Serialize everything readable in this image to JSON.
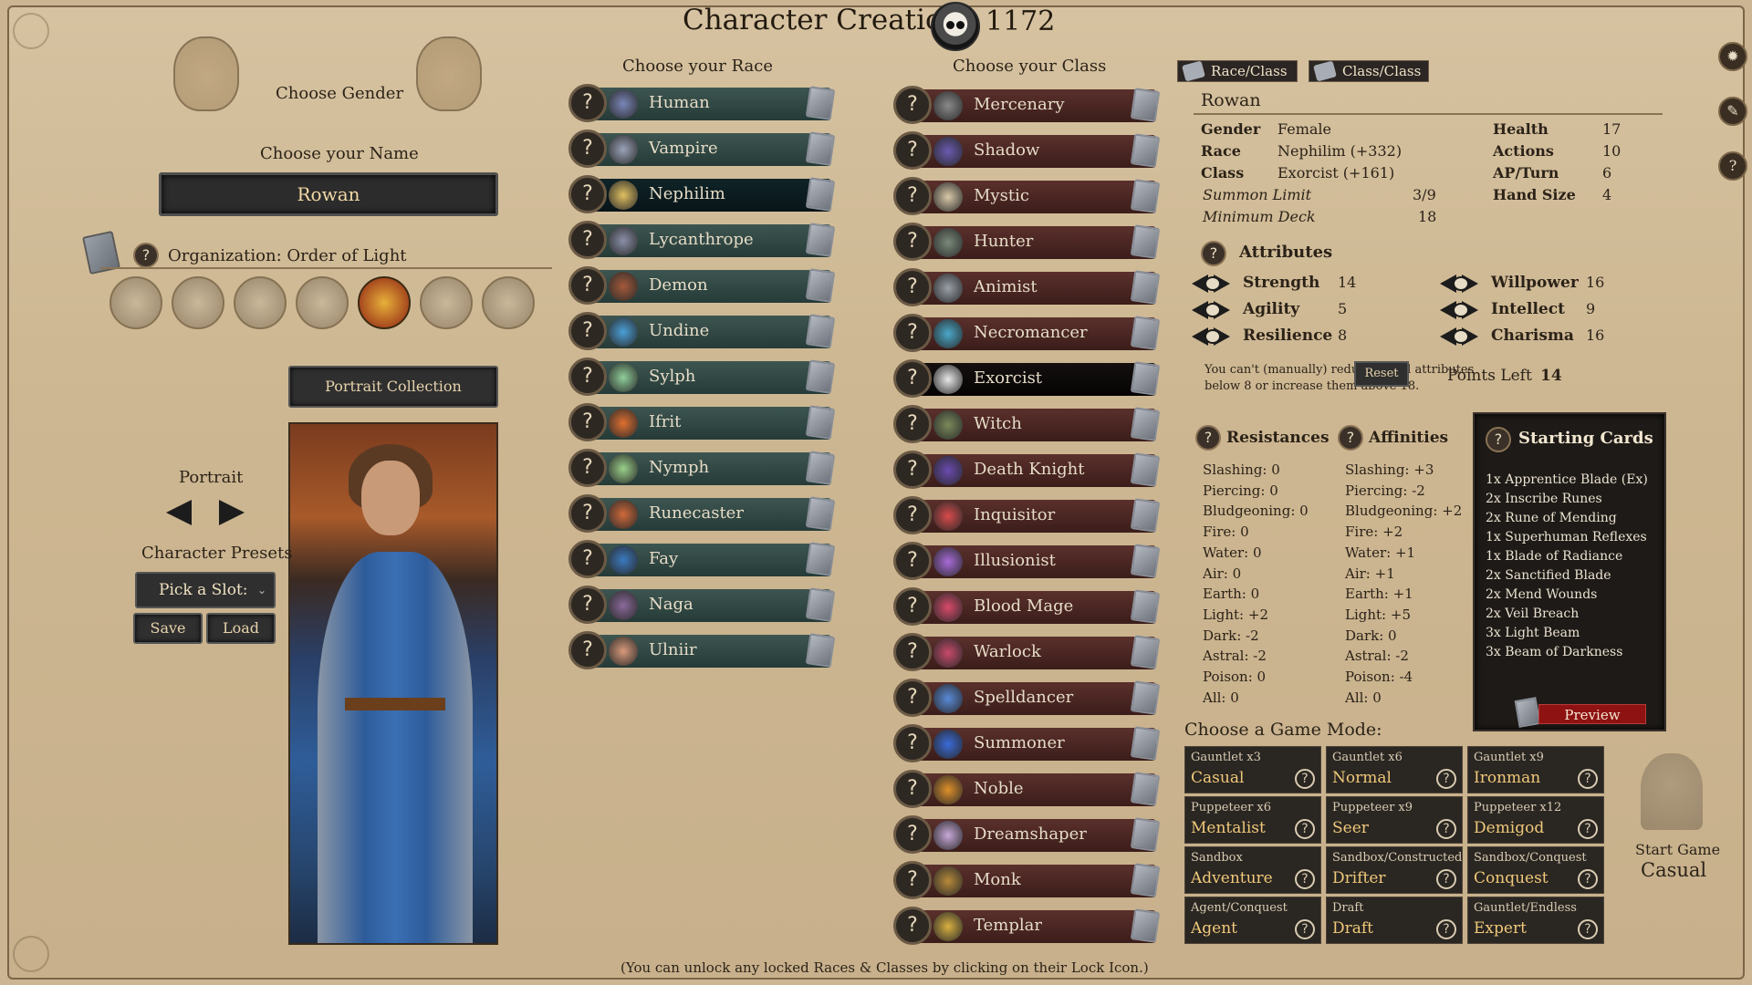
{
  "header": {
    "title": "Character Creation",
    "gold": "1172"
  },
  "left": {
    "gender_label": "Choose Gender",
    "name_label": "Choose your Name",
    "name_value": "Rowan",
    "organization": "Organization: Order of Light",
    "portrait_collection": "Portrait Collection",
    "portrait_label": "Portrait",
    "presets_label": "Character Presets",
    "preset_select": "Pick a Slot:",
    "save": "Save",
    "load": "Load"
  },
  "races": {
    "heading": "Choose your Race",
    "selected": "Nephilim",
    "items": [
      "Human",
      "Vampire",
      "Nephilim",
      "Lycanthrope",
      "Demon",
      "Undine",
      "Sylph",
      "Ifrit",
      "Nymph",
      "Runecaster",
      "Fay",
      "Naga",
      "Ulniir"
    ],
    "icon_colors": [
      "#7a86b8",
      "#9aa3b8",
      "#e0c060",
      "#8a90a8",
      "#a45a3a",
      "#4aa0d8",
      "#8fcf9a",
      "#e07030",
      "#9ad08a",
      "#d06a3a",
      "#3a7ac0",
      "#8a6a9a",
      "#d89a7a"
    ]
  },
  "classes": {
    "heading": "Choose your Class",
    "selected": "Exorcist",
    "items": [
      "Mercenary",
      "Shadow",
      "Mystic",
      "Hunter",
      "Animist",
      "Necromancer",
      "Exorcist",
      "Witch",
      "Death Knight",
      "Inquisitor",
      "Illusionist",
      "Blood Mage",
      "Warlock",
      "Spelldancer",
      "Summoner",
      "Noble",
      "Dreamshaper",
      "Monk",
      "Templar"
    ],
    "icon_colors": [
      "#8a8a8a",
      "#6a5ab0",
      "#d8c8a8",
      "#7a8a7a",
      "#9aa0a8",
      "#4aa8c8",
      "#e8e8e8",
      "#7a8a5a",
      "#6a4ab0",
      "#d84a4a",
      "#a86ad8",
      "#d84a6a",
      "#c84a6a",
      "#5a8ad8",
      "#3a6ad8",
      "#e0902a",
      "#c8a8d8",
      "#b88a3a",
      "#d8b040"
    ]
  },
  "tabs": [
    "Race/Class",
    "Class/Class"
  ],
  "summary": {
    "name": "Rowan",
    "rows": [
      {
        "k": "Gender",
        "v": "Female"
      },
      {
        "k": "Race",
        "v": "Nephilim (+332)"
      },
      {
        "k": "Class",
        "v": "Exorcist (+161)"
      }
    ],
    "summon_limit_label": "Summon Limit",
    "summon_limit": "3/9",
    "min_deck_label": "Minimum Deck",
    "min_deck": "18",
    "stats": [
      {
        "k": "Health",
        "v": "17"
      },
      {
        "k": "Actions",
        "v": "10"
      },
      {
        "k": "AP/Turn",
        "v": "6"
      },
      {
        "k": "Hand Size",
        "v": "4"
      }
    ]
  },
  "attributes": {
    "heading": "Attributes",
    "left": [
      {
        "k": "Strength",
        "v": "14"
      },
      {
        "k": "Agility",
        "v": "5"
      },
      {
        "k": "Resilience",
        "v": "8"
      }
    ],
    "right": [
      {
        "k": "Willpower",
        "v": "16"
      },
      {
        "k": "Intellect",
        "v": "9"
      },
      {
        "k": "Charisma",
        "v": "16"
      }
    ],
    "note_1": "You can't (manually) reduce initial attributes",
    "note_2": "below 8 or increase them above 18.",
    "points_label": "Points Left",
    "points": "14",
    "reset": "Reset"
  },
  "resistances": {
    "heading": "Resistances",
    "items": [
      "Slashing: 0",
      "Piercing: 0",
      "Bludgeoning: 0",
      "Fire: 0",
      "Water: 0",
      "Air: 0",
      "Earth: 0",
      "Light: +2",
      "Dark: -2",
      "Astral: -2",
      "Poison: 0",
      "All: 0"
    ]
  },
  "affinities": {
    "heading": "Affinities",
    "items": [
      "Slashing: +3",
      "Piercing: -2",
      "Bludgeoning: +2",
      "Fire: +2",
      "Water: +1",
      "Air: +1",
      "Earth: +1",
      "Light: +5",
      "Dark: 0",
      "Astral: -2",
      "Poison: -4",
      "All: 0"
    ]
  },
  "starting_cards": {
    "heading": "Starting Cards",
    "items": [
      "1x Apprentice Blade (Ex)",
      "2x Inscribe Runes",
      "2x Rune of Mending",
      "1x Superhuman Reflexes",
      "1x Blade of Radiance",
      "2x Sanctified Blade",
      "2x Mend Wounds",
      "2x Veil Breach",
      "3x Light Beam",
      "3x Beam of Darkness"
    ],
    "preview": "Preview"
  },
  "game_mode": {
    "heading": "Choose a Game Mode:",
    "modes": [
      {
        "t": "Gauntlet x3",
        "n": "Casual"
      },
      {
        "t": "Gauntlet x6",
        "n": "Normal"
      },
      {
        "t": "Gauntlet x9",
        "n": "Ironman"
      },
      {
        "t": "Puppeteer x6",
        "n": "Mentalist"
      },
      {
        "t": "Puppeteer x9",
        "n": "Seer"
      },
      {
        "t": "Puppeteer x12",
        "n": "Demigod"
      },
      {
        "t": "Sandbox",
        "n": "Adventure"
      },
      {
        "t": "Sandbox/Constructed",
        "n": "Drifter"
      },
      {
        "t": "Sandbox/Conquest",
        "n": "Conquest"
      },
      {
        "t": "Agent/Conquest",
        "n": "Agent"
      },
      {
        "t": "Draft",
        "n": "Draft"
      },
      {
        "t": "Gauntlet/Endless",
        "n": "Expert"
      }
    ],
    "start_label": "Start Game",
    "start_mode": "Casual"
  },
  "footer": "(You can unlock any locked Races & Classes by clicking on their Lock Icon.)",
  "icons": {
    "question": "?",
    "arrow_left": "◀",
    "arrow_right": "▶"
  }
}
